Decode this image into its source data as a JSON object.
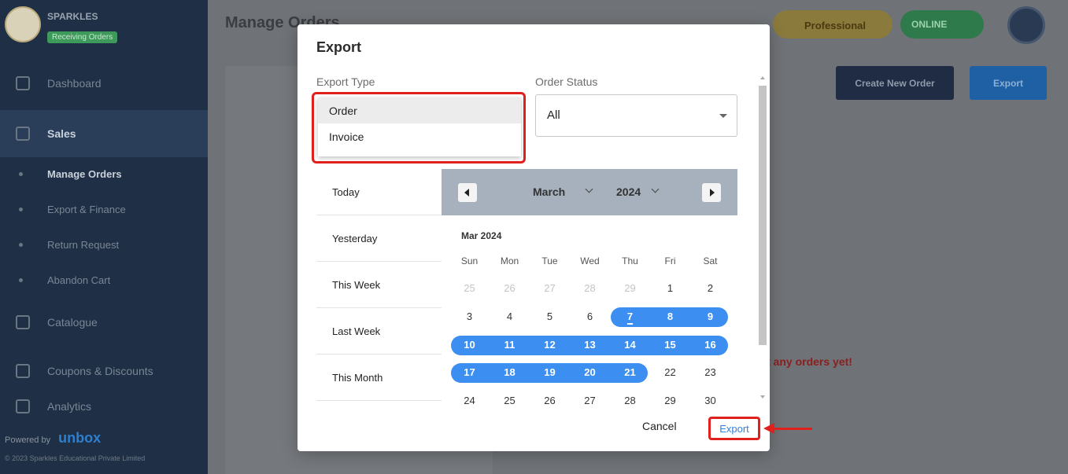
{
  "sidebar": {
    "store_name": "SPARKLES",
    "store_badge": "Receiving Orders",
    "items": [
      {
        "label": "Dashboard"
      },
      {
        "label": "Sales"
      },
      {
        "label": "Catalogue"
      },
      {
        "label": "Coupons & Discounts"
      },
      {
        "label": "Analytics"
      }
    ],
    "sub_items": [
      {
        "label": "Manage Orders"
      },
      {
        "label": "Export & Finance"
      },
      {
        "label": "Return Request"
      },
      {
        "label": "Abandon Cart"
      }
    ],
    "powered_by": "Powered by",
    "powered_brand": "unbox",
    "copyright": "© 2023 Sparkles Educational Private Limited"
  },
  "header": {
    "page_title": "Manage Orders",
    "plan_label": "Professional",
    "status_label": "ONLINE"
  },
  "toolbar": {
    "create_label": "Create New Order",
    "export_label": "Export"
  },
  "empty_state": "t any orders yet!",
  "modal": {
    "title": "Export",
    "export_type_label": "Export Type",
    "order_status_label": "Order Status",
    "order_status_value": "All",
    "export_type_options": [
      "Order",
      "Invoice"
    ],
    "presets": [
      "Today",
      "Yesterday",
      "This Week",
      "Last Week",
      "This Month"
    ],
    "calendar": {
      "month": "March",
      "year": "2024",
      "caption": "Mar 2024",
      "weekdays": [
        "Sun",
        "Mon",
        "Tue",
        "Wed",
        "Thu",
        "Fri",
        "Sat"
      ],
      "weeks": [
        [
          "25",
          "26",
          "27",
          "28",
          "29",
          "1",
          "2"
        ],
        [
          "3",
          "4",
          "5",
          "6",
          "7",
          "8",
          "9"
        ],
        [
          "10",
          "11",
          "12",
          "13",
          "14",
          "15",
          "16"
        ],
        [
          "17",
          "18",
          "19",
          "20",
          "21",
          "22",
          "23"
        ],
        [
          "24",
          "25",
          "26",
          "27",
          "28",
          "29",
          "30"
        ]
      ]
    },
    "cancel_label": "Cancel",
    "export_label": "Export"
  },
  "colors": {
    "accent": "#3c8ff0",
    "highlight": "#e0201c",
    "sidebar": "#1e2f46"
  }
}
